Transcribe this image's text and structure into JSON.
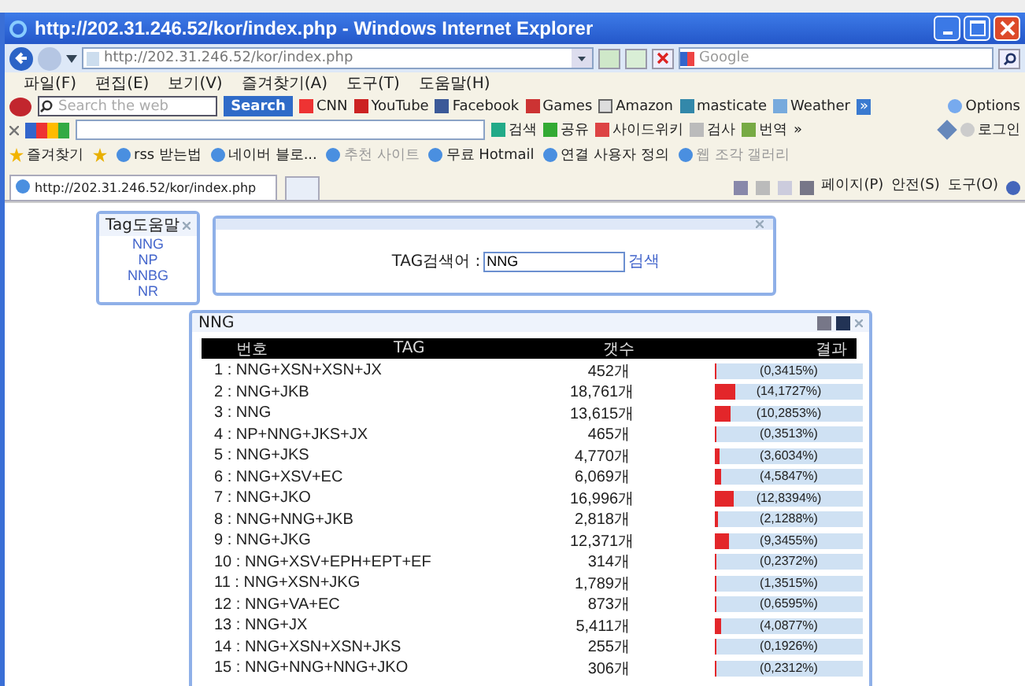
{
  "window": {
    "title": "http://202.31.246.52/kor/index.php - Windows Internet Explorer"
  },
  "address_bar": {
    "url": "http://202.31.246.52/kor/index.php",
    "search_placeholder": "Google"
  },
  "menu": [
    "파일(F)",
    "편집(E)",
    "보기(V)",
    "즐겨찾기(A)",
    "도구(T)",
    "도움말(H)"
  ],
  "ask_toolbar": {
    "search_placeholder": "Search the web",
    "search_button": "Search",
    "links": [
      "CNN",
      "YouTube",
      "Facebook",
      "Games",
      "Amazon",
      "masticate",
      "Weather"
    ],
    "more": "»",
    "options": "Options"
  },
  "google_toolbar": {
    "items": [
      "검색",
      "공유",
      "사이드위키",
      "검사",
      "번역"
    ],
    "more": "»",
    "login": "로그인"
  },
  "favorites_bar": {
    "label": "즐겨찾기",
    "items": [
      {
        "label": "rss 받는법",
        "disabled": false
      },
      {
        "label": "네이버 블로...",
        "disabled": false
      },
      {
        "label": "추천 사이트",
        "disabled": true
      },
      {
        "label": "무료 Hotmail",
        "disabled": false
      },
      {
        "label": "연결 사용자 정의",
        "disabled": false
      },
      {
        "label": "웹 조각 갤러리",
        "disabled": true
      }
    ]
  },
  "tab": {
    "label": "http://202.31.246.52/kor/index.php"
  },
  "command_bar": [
    "페이지(P)",
    "안전(S)",
    "도구(O)"
  ],
  "tag_help": {
    "title": "Tag도움말",
    "items": [
      "NNG",
      "NP",
      "NNBG",
      "NR"
    ]
  },
  "search_panel": {
    "label": "TAG검색어 :",
    "value": "NNG",
    "button": "검색"
  },
  "results": {
    "title": "NNG",
    "columns": [
      "번호",
      "TAG",
      "갯수",
      "결과"
    ],
    "rows": [
      {
        "label": "1 : NNG+XSN+XSN+JX",
        "count": "452개",
        "percent": "(0,3415%)",
        "level": 0.0034
      },
      {
        "label": "2 : NNG+JKB",
        "count": "18,761개",
        "percent": "(14,1727%)",
        "level": 0.1417
      },
      {
        "label": "3 : NNG",
        "count": "13,615개",
        "percent": "(10,2853%)",
        "level": 0.1029
      },
      {
        "label": "4 : NP+NNG+JKS+JX",
        "count": "465개",
        "percent": "(0,3513%)",
        "level": 0.0035
      },
      {
        "label": "5 : NNG+JKS",
        "count": "4,770개",
        "percent": "(3,6034%)",
        "level": 0.036
      },
      {
        "label": "6 : NNG+XSV+EC",
        "count": "6,069개",
        "percent": "(4,5847%)",
        "level": 0.0458
      },
      {
        "label": "7 : NNG+JKO",
        "count": "16,996개",
        "percent": "(12,8394%)",
        "level": 0.1284
      },
      {
        "label": "8 : NNG+NNG+JKB",
        "count": "2,818개",
        "percent": "(2,1288%)",
        "level": 0.0213
      },
      {
        "label": "9 : NNG+JKG",
        "count": "12,371개",
        "percent": "(9,3455%)",
        "level": 0.0935
      },
      {
        "label": "10 : NNG+XSV+EPH+EPT+EF",
        "count": "314개",
        "percent": "(0,2372%)",
        "level": 0.0024
      },
      {
        "label": "11 : NNG+XSN+JKG",
        "count": "1,789개",
        "percent": "(1,3515%)",
        "level": 0.0135
      },
      {
        "label": "12 : NNG+VA+EC",
        "count": "873개",
        "percent": "(0,6595%)",
        "level": 0.0066
      },
      {
        "label": "13 : NNG+JX",
        "count": "5,411개",
        "percent": "(4,0877%)",
        "level": 0.0409
      },
      {
        "label": "14 : NNG+XSN+XSN+JKS",
        "count": "255개",
        "percent": "(0,1926%)",
        "level": 0.0019
      },
      {
        "label": "15 : NNG+NNG+NNG+JKO",
        "count": "306개",
        "percent": "(0,2312%)",
        "level": 0.0023
      }
    ]
  }
}
